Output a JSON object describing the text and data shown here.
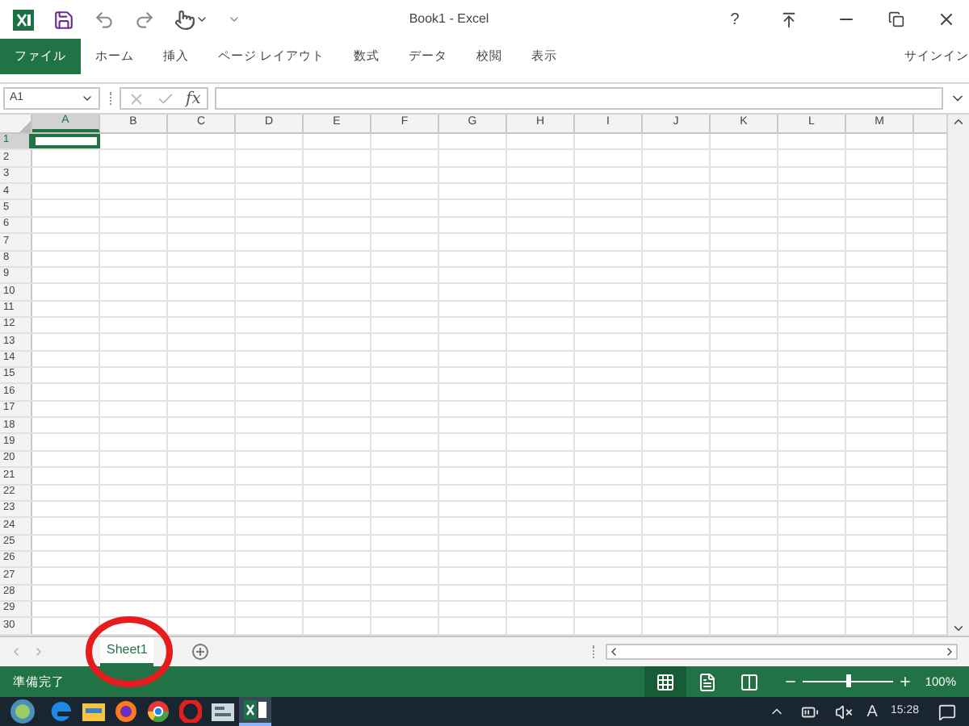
{
  "window": {
    "title": "Book1 - Excel",
    "help": "?"
  },
  "ribbon_tabs": [
    {
      "label": "ファイル",
      "selected": true
    },
    {
      "label": "ホーム",
      "selected": false
    },
    {
      "label": "挿入",
      "selected": false
    },
    {
      "label": "ページ レイアウト",
      "selected": false
    },
    {
      "label": "数式",
      "selected": false
    },
    {
      "label": "データ",
      "selected": false
    },
    {
      "label": "校閲",
      "selected": false
    },
    {
      "label": "表示",
      "selected": false
    }
  ],
  "sign_in": "サインイン",
  "formula_bar": {
    "name_box": "A1",
    "fx": "fx"
  },
  "columns": [
    {
      "label": "A",
      "selected": true
    },
    {
      "label": "B",
      "selected": false
    },
    {
      "label": "C",
      "selected": false
    },
    {
      "label": "D",
      "selected": false
    },
    {
      "label": "E",
      "selected": false
    },
    {
      "label": "F",
      "selected": false
    },
    {
      "label": "G",
      "selected": false
    },
    {
      "label": "H",
      "selected": false
    },
    {
      "label": "I",
      "selected": false
    },
    {
      "label": "J",
      "selected": false
    },
    {
      "label": "K",
      "selected": false
    },
    {
      "label": "L",
      "selected": false
    },
    {
      "label": "M",
      "selected": false
    }
  ],
  "rows": [
    {
      "label": "1",
      "selected": true
    },
    {
      "label": "2",
      "selected": false
    },
    {
      "label": "3",
      "selected": false
    },
    {
      "label": "4",
      "selected": false
    },
    {
      "label": "5",
      "selected": false
    },
    {
      "label": "6",
      "selected": false
    },
    {
      "label": "7",
      "selected": false
    },
    {
      "label": "8",
      "selected": false
    },
    {
      "label": "9",
      "selected": false
    },
    {
      "label": "10",
      "selected": false
    },
    {
      "label": "11",
      "selected": false
    },
    {
      "label": "12",
      "selected": false
    },
    {
      "label": "13",
      "selected": false
    },
    {
      "label": "14",
      "selected": false
    },
    {
      "label": "15",
      "selected": false
    },
    {
      "label": "16",
      "selected": false
    },
    {
      "label": "17",
      "selected": false
    },
    {
      "label": "18",
      "selected": false
    },
    {
      "label": "19",
      "selected": false
    },
    {
      "label": "20",
      "selected": false
    },
    {
      "label": "21",
      "selected": false
    },
    {
      "label": "22",
      "selected": false
    },
    {
      "label": "23",
      "selected": false
    },
    {
      "label": "24",
      "selected": false
    },
    {
      "label": "25",
      "selected": false
    },
    {
      "label": "26",
      "selected": false
    },
    {
      "label": "27",
      "selected": false
    },
    {
      "label": "28",
      "selected": false
    },
    {
      "label": "29",
      "selected": false
    },
    {
      "label": "30",
      "selected": false
    }
  ],
  "sheet_tabs": [
    {
      "label": "Sheet1",
      "selected": true
    }
  ],
  "status_bar": {
    "text": "準備完了",
    "views": [
      {
        "kind": "normal",
        "selected": true
      },
      {
        "kind": "page_layout",
        "selected": false
      },
      {
        "kind": "page_break",
        "selected": false
      }
    ],
    "zoom": {
      "level": 0.5,
      "reading": "100%"
    }
  },
  "taskbar": {
    "apps": [
      {
        "kind": "edge",
        "active": false
      },
      {
        "kind": "explorer",
        "active": false
      },
      {
        "kind": "firefox",
        "active": false
      },
      {
        "kind": "chrome",
        "active": false
      },
      {
        "kind": "opera",
        "active": false
      },
      {
        "kind": "app",
        "active": false
      },
      {
        "kind": "excel",
        "active": true
      }
    ],
    "ime": "A",
    "time": "15:28"
  }
}
